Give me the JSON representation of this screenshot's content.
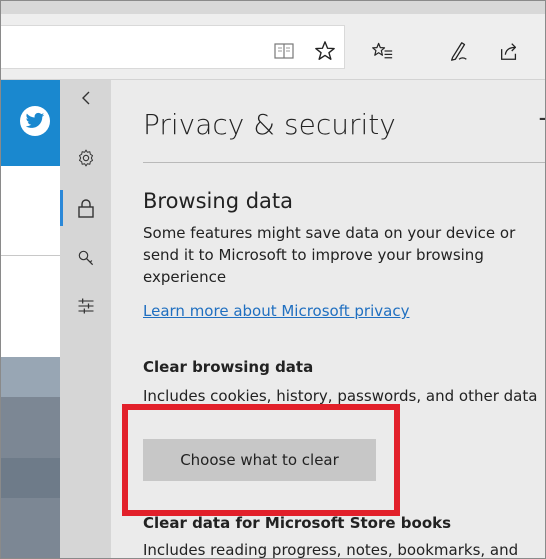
{
  "toolbar": {
    "icons": [
      "reading-view-icon",
      "favorite-star-icon",
      "favorites-list-icon",
      "notes-pen-icon",
      "share-icon"
    ]
  },
  "page": {
    "icons": [
      "twitter-icon"
    ]
  },
  "rail": {
    "items": [
      {
        "name": "back-chevron-icon",
        "active": false
      },
      {
        "name": "gear-icon",
        "active": false
      },
      {
        "name": "lock-icon",
        "active": true
      },
      {
        "name": "search-key-icon",
        "active": false
      },
      {
        "name": "sliders-icon",
        "active": false
      }
    ]
  },
  "pane": {
    "title": "Privacy & security",
    "pin_symbol": "+",
    "browsing": {
      "title": "Browsing data",
      "description": "Some features might save data on your device or send it to Microsoft to improve your browsing experience",
      "link": "Learn more about Microsoft privacy"
    },
    "clear": {
      "title": "Clear browsing data",
      "description": "Includes cookies, history, passwords, and other data",
      "button": "Choose what to clear"
    },
    "store": {
      "title": "Clear data for Microsoft Store books",
      "description": "Includes reading progress, notes, bookmarks, and"
    }
  },
  "colors": {
    "highlight": "#e2202a",
    "accent": "#2b88d8",
    "link": "#1f6fc0",
    "pane_bg": "#ebebeb"
  }
}
